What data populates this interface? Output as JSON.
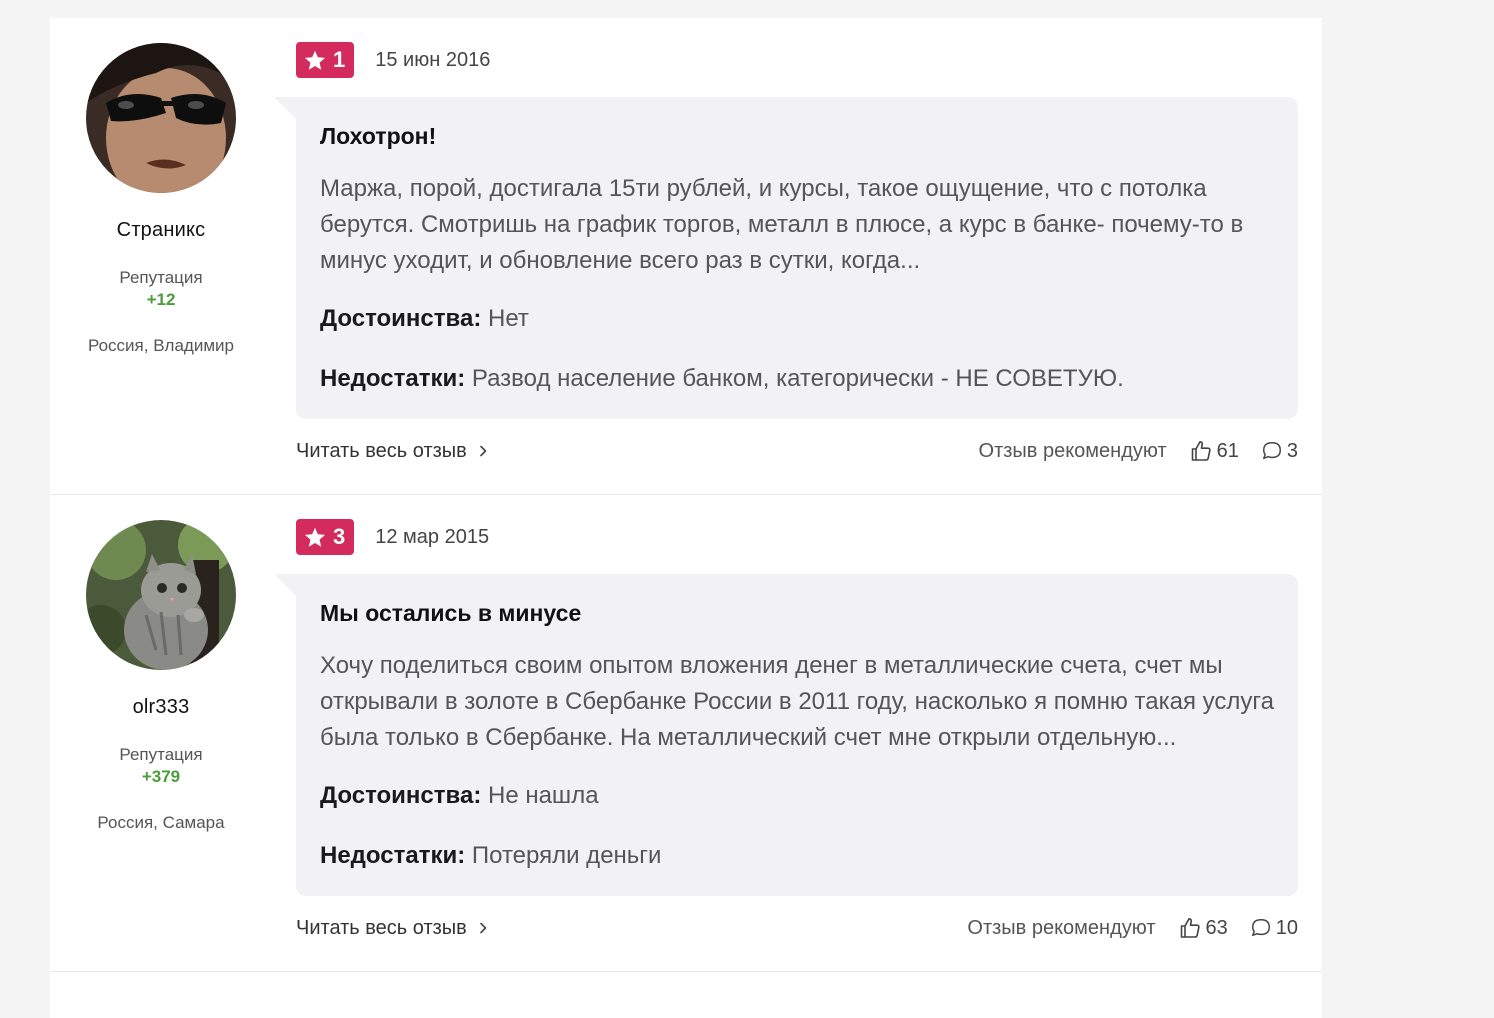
{
  "reviews": [
    {
      "author": {
        "name": "Страникс",
        "reputation_label": "Репутация",
        "reputation_value": "+12",
        "location": "Россия, Владимир"
      },
      "rating": "1",
      "date": "15 июн 2016",
      "title": "Лохотрон!",
      "text": "Маржа, порой, достигала 15ти рублей, и курсы, такое ощущение, что с потолка берутся. Смотришь на график торгов, металл в плюсе, а курс в банке- почему-то в минус уходит, и обновление всего раз в сутки, когда...",
      "pros_label": "Достоинства:",
      "pros": "Нет",
      "cons_label": "Недостатки:",
      "cons": "Развод население банком, категорически - НЕ СОВЕТУЮ.",
      "read_more": "Читать весь отзыв",
      "recommend_label": "Отзыв рекомендуют",
      "likes": "61",
      "comments": "3"
    },
    {
      "author": {
        "name": "olr333",
        "reputation_label": "Репутация",
        "reputation_value": "+379",
        "location": "Россия, Самара"
      },
      "rating": "3",
      "date": "12 мар 2015",
      "title": "Мы остались в минусе",
      "text": "Хочу поделиться своим опытом вложения денег в металлические счета, счет мы открывали в золоте в Сбербанке России в 2011 году, насколько я помню такая услуга была только в Сбербанке. На металлический счет мне открыли отдельную...",
      "pros_label": "Достоинства:",
      "pros": "Не нашла",
      "cons_label": "Недостатки:",
      "cons": "Потеряли деньги",
      "read_more": "Читать весь отзыв",
      "recommend_label": "Отзыв рекомендуют",
      "likes": "63",
      "comments": "10"
    }
  ],
  "colors": {
    "rating_badge": "#d42b5e",
    "reputation": "#4a9d3a",
    "bubble": "#f2f2f4"
  },
  "icons": {
    "rating": "star-icon",
    "read_more": "chevron-right-icon",
    "likes": "thumbs-up-icon",
    "comments": "comment-bubble-icon"
  }
}
